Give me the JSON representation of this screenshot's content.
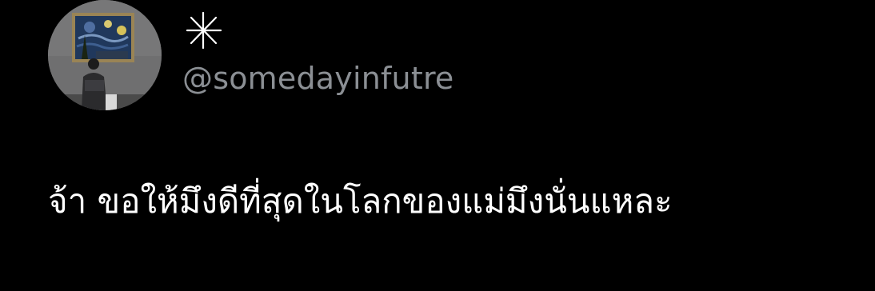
{
  "author": {
    "display_name": "☆",
    "handle": "@somedayinfutre",
    "avatar_icon": "profile-photo-person-viewing-starry-night-painting"
  },
  "tweet": {
    "text": "จ้า ขอให้มึงดีที่สุดในโลกของแม่มึงนั่นแหละ"
  },
  "colors": {
    "background": "#000000",
    "text_primary": "#ffffff",
    "text_secondary": "#8b8f94",
    "avatar_bg": "#6e6e6e"
  }
}
